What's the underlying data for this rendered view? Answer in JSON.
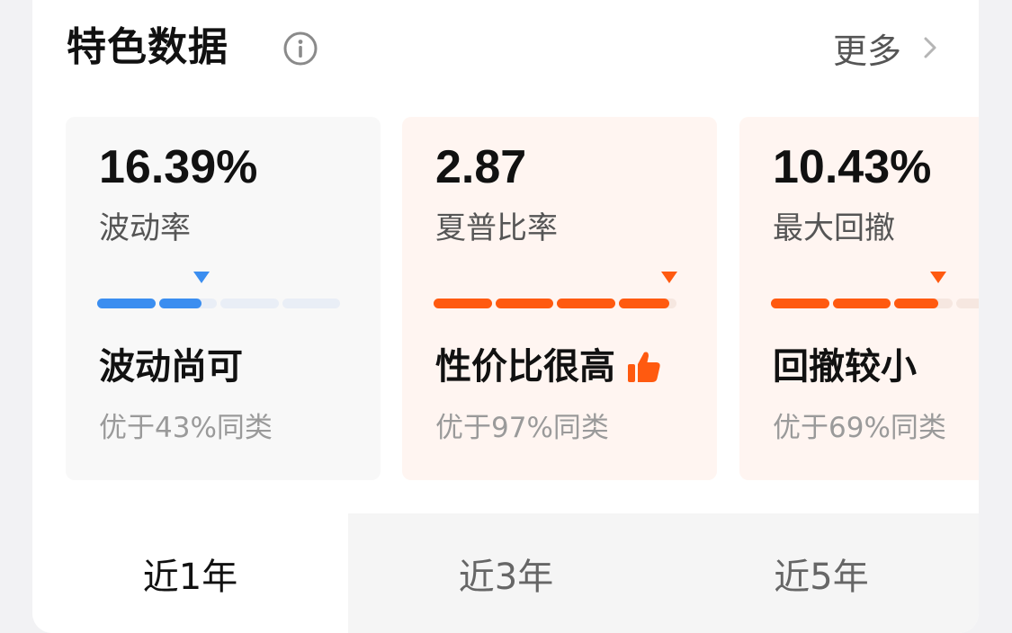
{
  "header": {
    "title": "特色数据",
    "more_label": "更多"
  },
  "cards": [
    {
      "value": "16.39%",
      "metric": "波动率",
      "verdict": "波动尚可",
      "rank": "优于43%同类",
      "level": 0.43,
      "accent": "#3b8ef0",
      "track": "#e9eef6",
      "tone": "neutral",
      "thumb": false
    },
    {
      "value": "2.87",
      "metric": "夏普比率",
      "verdict": "性价比很高",
      "rank": "优于97%同类",
      "level": 0.97,
      "accent": "#ff5a10",
      "track": "#f6e7e0",
      "tone": "warm",
      "thumb": true
    },
    {
      "value": "10.43%",
      "metric": "最大回撤",
      "verdict": "回撤较小",
      "rank": "优于69%同类",
      "level": 0.69,
      "accent": "#ff5a10",
      "track": "#f6e7e0",
      "tone": "warm",
      "thumb": false
    }
  ],
  "tabs": [
    {
      "label": "近1年",
      "active": true
    },
    {
      "label": "近3年",
      "active": false
    },
    {
      "label": "近5年",
      "active": false
    }
  ],
  "icons": {
    "info": "info-icon",
    "more": "chevron-right-icon",
    "thumb": "thumbs-up-icon"
  }
}
